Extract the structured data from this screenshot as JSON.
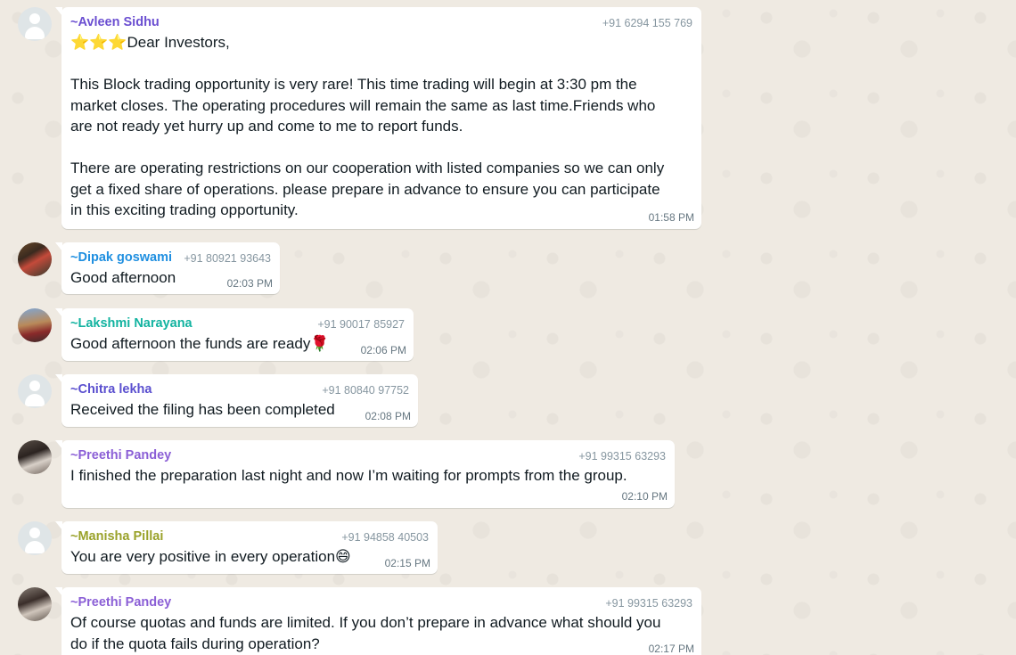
{
  "messages": [
    {
      "sender": "~Avleen Sidhu",
      "sender_color": "#6b4fd1",
      "phone": "+91 6294 155 769",
      "text": "⭐⭐⭐Dear Investors,\n\nThis Block trading opportunity is very rare! This time trading will begin at 3:30 pm the\nmarket closes. The operating procedures will remain the same as last time.Friends who\nare not ready yet hurry up and come to me to report funds.\n\nThere are operating restrictions on our cooperation with listed companies so we can only\nget a fixed share of operations. please prepare in advance to ensure you can participate\nin this exciting trading opportunity.",
      "time": "01:58 PM",
      "avatar": "default-avatar-icon"
    },
    {
      "sender": "~Dipak goswami",
      "sender_color": "#1f8fe0",
      "phone": "+91 80921 93643",
      "text": "Good afternoon",
      "time": "02:03 PM",
      "avatar": "profile-photo"
    },
    {
      "sender": "~Lakshmi Narayana",
      "sender_color": "#12b3a0",
      "phone": "+91 90017 85927",
      "text": "Good afternoon the funds are ready🌹",
      "time": "02:06 PM",
      "avatar": "profile-photo"
    },
    {
      "sender": "~Chitra lekha",
      "sender_color": "#5a4fcf",
      "phone": "+91 80840 97752",
      "text": "Received the filing has been completed",
      "time": "02:08 PM",
      "avatar": "default-avatar-icon"
    },
    {
      "sender": "~Preethi Pandey",
      "sender_color": "#8b5fd6",
      "phone": "+91 99315 63293",
      "text": "I finished the preparation last night and now I’m waiting for prompts from the group.",
      "time": "02:10 PM",
      "avatar": "profile-photo"
    },
    {
      "sender": "~Manisha Pillai",
      "sender_color": "#9aa22a",
      "phone": "+91 94858 40503",
      "text": "You are very positive in every operation😄",
      "time": "02:15 PM",
      "avatar": "default-avatar-icon"
    },
    {
      "sender": "~Preethi Pandey",
      "sender_color": "#8b5fd6",
      "phone": "+91 99315 63293",
      "text": "Of course quotas and funds are limited. If you don’t prepare in advance what should you\ndo if the quota fails during operation?",
      "time": "02:17 PM",
      "avatar": "profile-photo"
    }
  ]
}
